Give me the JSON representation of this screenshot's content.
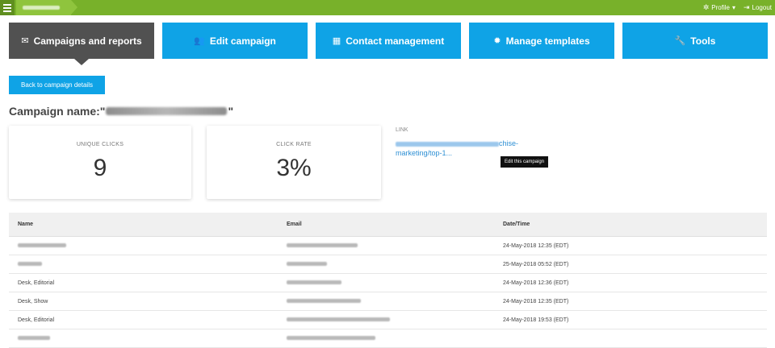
{
  "topbar": {
    "profile_label": "Profile",
    "profile_caret": "▾",
    "logout_label": "Logout"
  },
  "tabs": [
    {
      "label": "Campaigns and reports",
      "icon": "envelope-icon",
      "active": true
    },
    {
      "label": "Edit campaign",
      "icon": "users-icon",
      "active": false
    },
    {
      "label": "Contact management",
      "icon": "address-book-icon",
      "active": false
    },
    {
      "label": "Manage templates",
      "icon": "gear-icon",
      "active": false
    },
    {
      "label": "Tools",
      "icon": "wrench-icon",
      "active": false
    }
  ],
  "back_button": "Back to campaign details",
  "campaign": {
    "title_prefix": "Campaign name:\"",
    "title_suffix": "\""
  },
  "stats": {
    "unique_clicks_label": "UNIQUE CLICKS",
    "unique_clicks_value": "9",
    "click_rate_label": "CLICK RATE",
    "click_rate_value": "3%"
  },
  "link": {
    "label": "LINK",
    "url_visible_tail": "chise-",
    "url_line2": "marketing/top-1..."
  },
  "tooltip": "Edit this campaign",
  "table": {
    "headers": [
      "Name",
      "Email",
      "Date/Time"
    ],
    "rows": [
      {
        "name": "",
        "email": "",
        "datetime": "24-May-2018 12:35 (EDT)"
      },
      {
        "name": "",
        "email": "",
        "datetime": "25-May-2018 05:52 (EDT)"
      },
      {
        "name": "Desk, Editorial",
        "email": "",
        "datetime": "24-May-2018 12:36 (EDT)"
      },
      {
        "name": "Desk, Show",
        "email": "",
        "datetime": "24-May-2018 12:35 (EDT)"
      },
      {
        "name": "Desk, Editorial",
        "email": "",
        "datetime": "24-May-2018 19:53 (EDT)"
      }
    ]
  },
  "colors": {
    "topbar": "#78b12a",
    "tab_blue": "#0fa3e6",
    "tab_active": "#515151",
    "link": "#2d8fd4"
  }
}
